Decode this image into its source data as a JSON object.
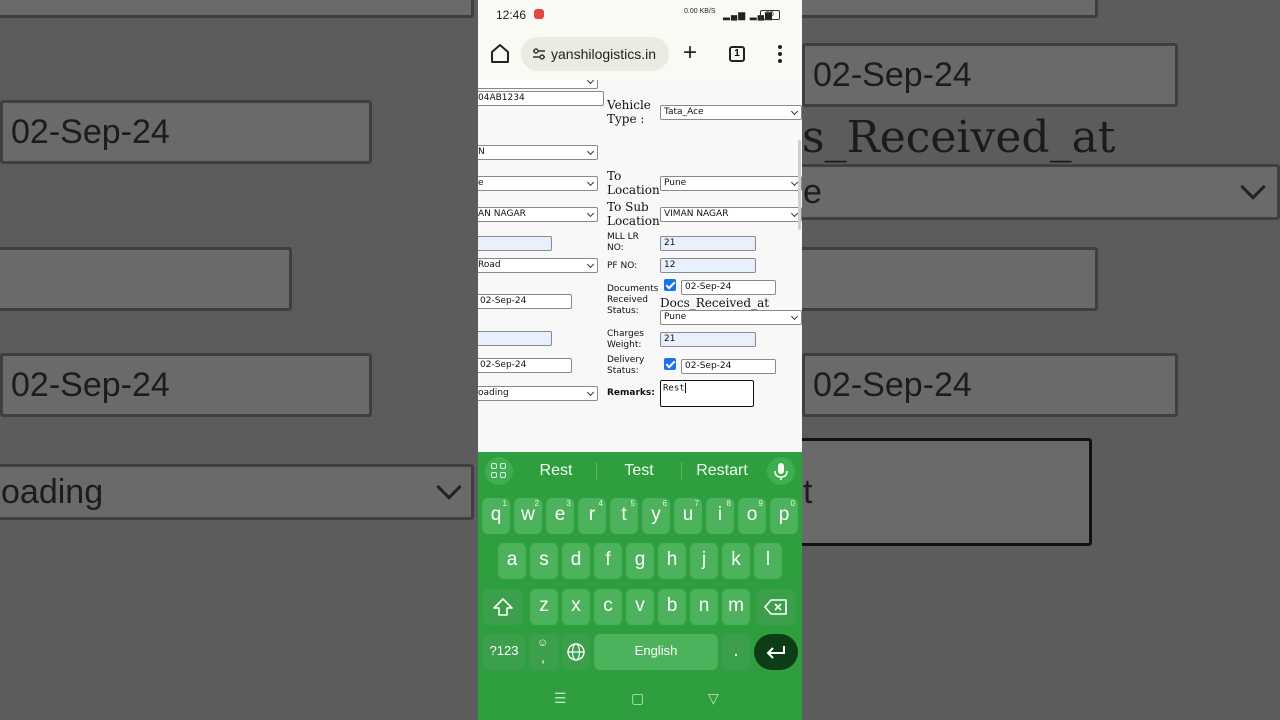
{
  "status_bar": {
    "time": "12:46",
    "network_speed": "0.00 KB/S",
    "network_type": "Vo LTE",
    "signal": "4G",
    "battery": "55"
  },
  "browser": {
    "url": "yanshilogistics.in",
    "tab_count": "1"
  },
  "form": {
    "left_column": {
      "vehicle_no_value": "04AB1234",
      "select1_value": "N",
      "from_location_value": "e",
      "from_sub_location_value": "AN NAGAR",
      "road_select_value": "Road",
      "date1_value": "02-Sep-24",
      "date2_value": "02-Sep-24",
      "status_select_value": "oading"
    },
    "vehicle_type_label": "Vehicle Type :",
    "vehicle_type_value": "Tata_Ace",
    "to_location_label": "To Location",
    "to_location_value": "Pune",
    "to_sub_location_label": "To Sub Location",
    "to_sub_location_value": "VIMAN NAGAR",
    "mll_lr_label": "MLL LR NO:",
    "mll_lr_value": "21",
    "pf_no_label": "PF NO:",
    "pf_no_value": "12",
    "documents_label": "Documents Received Status:",
    "documents_date": "02-Sep-24",
    "docs_received_at_label": "Docs_Received_at",
    "docs_received_at_value": "Pune",
    "charges_weight_label": "Charges Weight:",
    "charges_weight_value": "21",
    "delivery_status_label": "Delivery Status:",
    "delivery_date": "02-Sep-24",
    "remarks_label": "Remarks:",
    "remarks_value": "Rest"
  },
  "keyboard": {
    "suggestions": [
      "Rest",
      "Test",
      "Restart"
    ],
    "row1": [
      {
        "k": "q",
        "n": "1"
      },
      {
        "k": "w",
        "n": "2"
      },
      {
        "k": "e",
        "n": "3"
      },
      {
        "k": "r",
        "n": "4"
      },
      {
        "k": "t",
        "n": "5"
      },
      {
        "k": "y",
        "n": "6"
      },
      {
        "k": "u",
        "n": "7"
      },
      {
        "k": "i",
        "n": "8"
      },
      {
        "k": "o",
        "n": "9"
      },
      {
        "k": "p",
        "n": "0"
      }
    ],
    "row2": [
      "a",
      "s",
      "d",
      "f",
      "g",
      "h",
      "j",
      "k",
      "l"
    ],
    "row3": [
      "z",
      "x",
      "c",
      "v",
      "b",
      "n",
      "m"
    ],
    "symbols_key": "?123",
    "comma_key": ",",
    "space_label": "English",
    "period_key": "."
  },
  "background_zoom": {
    "left_date1": "02-Sep-24",
    "left_date2": "02-Sep-24",
    "left_select": "oading",
    "right_date1": "02-Sep-24",
    "right_label": "s_Received_at",
    "right_select": "e",
    "right_date2": "02-Sep-24",
    "right_text": "t"
  },
  "colors": {
    "keyboard_bg": "#2e9e3f",
    "key_bg": "#4cb35c",
    "enter_bg": "#0c3d16",
    "checkbox": "#1a73e8",
    "field_autofill": "#e8f0fe"
  }
}
